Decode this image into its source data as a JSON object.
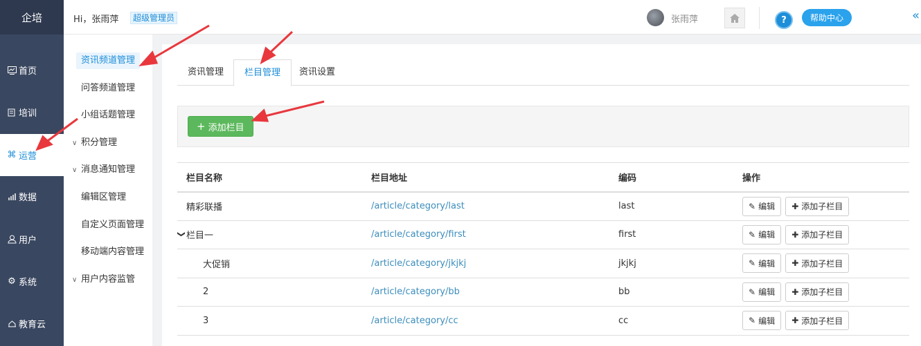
{
  "brand": "企培",
  "nav": {
    "items": [
      {
        "label": "首页",
        "icon": "dashboard-icon"
      },
      {
        "label": "培训",
        "icon": "book-icon"
      },
      {
        "label": "运营",
        "icon": "command-icon"
      },
      {
        "label": "数据",
        "icon": "chart-icon"
      },
      {
        "label": "用户",
        "icon": "user-icon"
      },
      {
        "label": "系统",
        "icon": "gear-icon"
      },
      {
        "label": "教育云",
        "icon": "cloud-icon"
      }
    ]
  },
  "header": {
    "greeting": "Hi，张雨萍",
    "role_badge": "超级管理员",
    "username": "张雨萍",
    "help_label": "帮助中心",
    "help_icon_text": "?",
    "collapse_text": "«"
  },
  "submenu": {
    "items": [
      {
        "label": "资讯频道管理",
        "chev": ""
      },
      {
        "label": "问答频道管理",
        "chev": ""
      },
      {
        "label": "小组话题管理",
        "chev": ""
      },
      {
        "label": "积分管理",
        "chev": "∨"
      },
      {
        "label": "消息通知管理",
        "chev": "∨"
      },
      {
        "label": "编辑区管理",
        "chev": ""
      },
      {
        "label": "自定义页面管理",
        "chev": ""
      },
      {
        "label": "移动端内容管理",
        "chev": ""
      },
      {
        "label": "用户内容监管",
        "chev": "∨"
      }
    ]
  },
  "tabs": [
    {
      "label": "资讯管理"
    },
    {
      "label": "栏目管理"
    },
    {
      "label": "资讯设置"
    }
  ],
  "toolbar": {
    "add_label": "添加栏目",
    "add_icon": "+"
  },
  "table": {
    "headers": [
      "栏目名称",
      "栏目地址",
      "编码",
      "操作"
    ],
    "edit_label": "编辑",
    "add_child_label": "添加子栏目",
    "rows": [
      {
        "name": "精彩联播",
        "url": "/article/category/last",
        "code": "last",
        "caret": ""
      },
      {
        "name": "栏目一",
        "url": "/article/category/first",
        "code": "first",
        "caret": "❯"
      },
      {
        "name": "大促销",
        "url": "/article/category/jkjkj",
        "code": "jkjkj",
        "caret": ""
      },
      {
        "name": "2",
        "url": "/article/category/bb",
        "code": "bb",
        "caret": ""
      },
      {
        "name": "3",
        "url": "/article/category/cc",
        "code": "cc",
        "caret": ""
      }
    ]
  },
  "colors": {
    "accent": "#1e8ed8",
    "nav_bg": "#3a4760",
    "success": "#5cb85c",
    "annotation": "#e8383d"
  }
}
